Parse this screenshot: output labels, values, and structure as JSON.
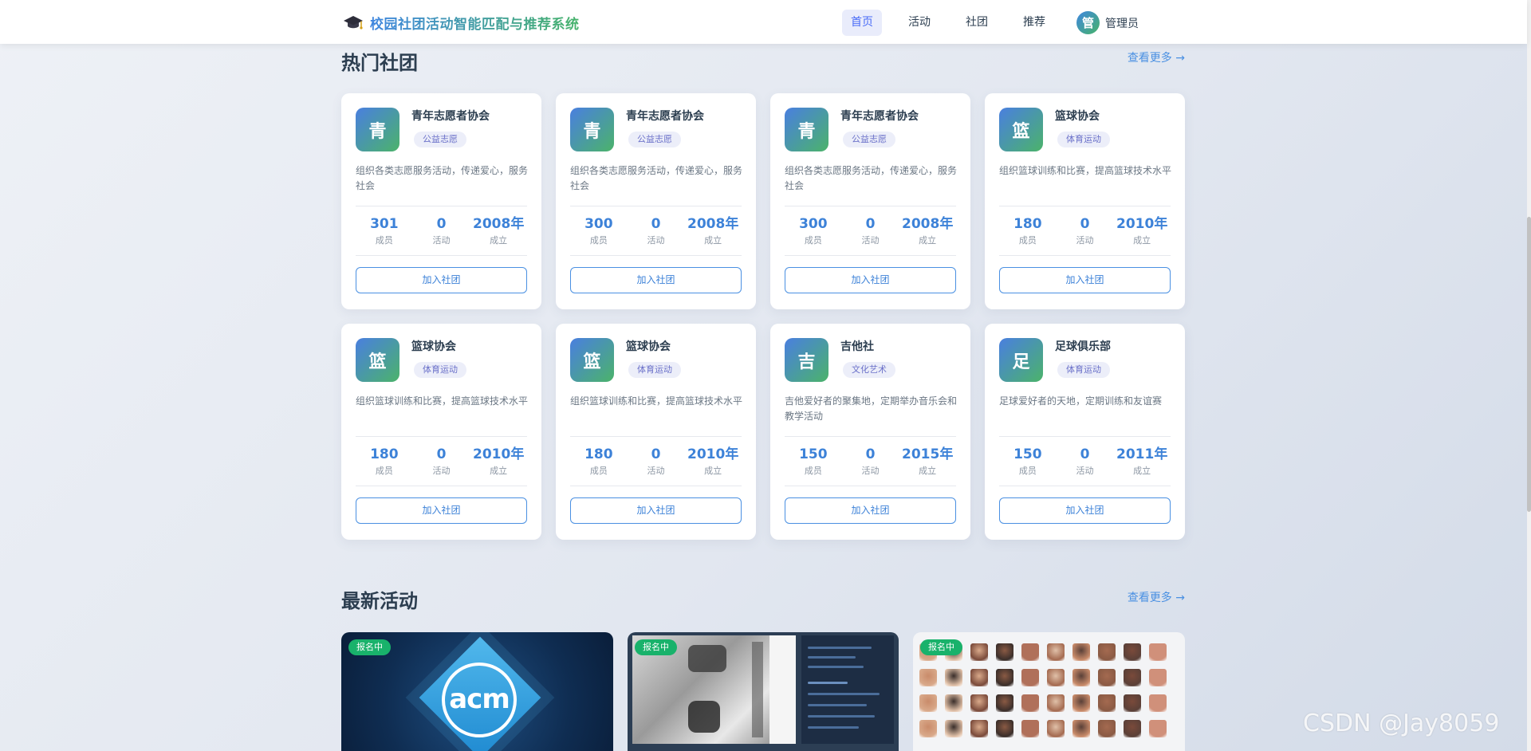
{
  "header": {
    "title": "校园社团活动智能匹配与推荐系统",
    "nav": [
      {
        "label": "首页",
        "active": true
      },
      {
        "label": "活动",
        "active": false
      },
      {
        "label": "社团",
        "active": false
      },
      {
        "label": "推荐",
        "active": false
      }
    ],
    "user": {
      "avatar": "管",
      "name": "管理员"
    }
  },
  "hot_clubs": {
    "title": "热门社团",
    "more": "查看更多 →",
    "join_label": "加入社团",
    "stat_labels": {
      "members": "成员",
      "activities": "活动",
      "founded": "成立"
    },
    "clubs": [
      {
        "logo": "青",
        "name": "青年志愿者协会",
        "tag": "公益志愿",
        "desc": "组织各类志愿服务活动，传递爱心，服务社会",
        "members": "301",
        "activities": "0",
        "founded": "2008年"
      },
      {
        "logo": "青",
        "name": "青年志愿者协会",
        "tag": "公益志愿",
        "desc": "组织各类志愿服务活动，传递爱心，服务社会",
        "members": "300",
        "activities": "0",
        "founded": "2008年"
      },
      {
        "logo": "青",
        "name": "青年志愿者协会",
        "tag": "公益志愿",
        "desc": "组织各类志愿服务活动，传递爱心，服务社会",
        "members": "300",
        "activities": "0",
        "founded": "2008年"
      },
      {
        "logo": "篮",
        "name": "篮球协会",
        "tag": "体育运动",
        "desc": "组织篮球训练和比赛，提高篮球技术水平",
        "members": "180",
        "activities": "0",
        "founded": "2010年"
      },
      {
        "logo": "篮",
        "name": "篮球协会",
        "tag": "体育运动",
        "desc": "组织篮球训练和比赛，提高篮球技术水平",
        "members": "180",
        "activities": "0",
        "founded": "2010年"
      },
      {
        "logo": "篮",
        "name": "篮球协会",
        "tag": "体育运动",
        "desc": "组织篮球训练和比赛，提高篮球技术水平",
        "members": "180",
        "activities": "0",
        "founded": "2010年"
      },
      {
        "logo": "吉",
        "name": "吉他社",
        "tag": "文化艺术",
        "desc": "吉他爱好者的聚集地，定期举办音乐会和教学活动",
        "members": "150",
        "activities": "0",
        "founded": "2015年"
      },
      {
        "logo": "足",
        "name": "足球俱乐部",
        "tag": "体育运动",
        "desc": "足球爱好者的天地，定期训练和友谊赛",
        "members": "150",
        "activities": "0",
        "founded": "2011年"
      }
    ]
  },
  "latest_activities": {
    "title": "最新活动",
    "more": "查看更多 →",
    "items": [
      {
        "badge": "报名中",
        "image": "acm-logo",
        "logo_text": "acm"
      },
      {
        "badge": "报名中",
        "image": "ocr-screenshot"
      },
      {
        "badge": "报名中",
        "image": "face-grid"
      }
    ]
  },
  "watermark": "CSDN @Jay8059"
}
